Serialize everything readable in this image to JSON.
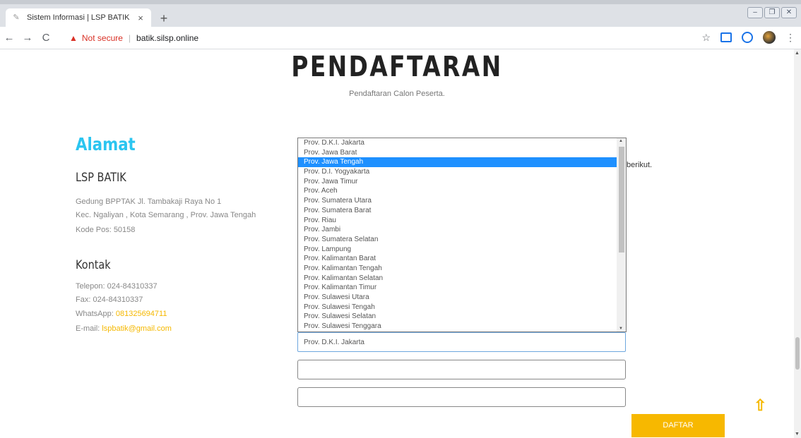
{
  "browser": {
    "tab_title": "Sistem Informasi | LSP BATIK",
    "tab_close": "×",
    "new_tab": "+",
    "security_text": "Not secure",
    "url": "batik.silsp.online"
  },
  "page": {
    "heading": "PENDAFTARAN",
    "subheading": "Pendaftaran Calon Peserta."
  },
  "sidebar": {
    "alamat_title": "Alamat",
    "org_name": "LSP BATIK",
    "address_line1": "Gedung BPPTAK Jl. Tambakaji Raya No 1",
    "address_line2": "Kec. Ngaliyan , Kota Semarang , Prov. Jawa Tengah",
    "postal": "Kode Pos: 50158",
    "kontak_title": "Kontak",
    "telepon": "Telepon: 024-84310337",
    "fax": "Fax: 024-84310337",
    "whatsapp_label": "WhatsApp: ",
    "whatsapp_value": "081325694711",
    "email_label": "E-mail: ",
    "email_value": "lspbatik@gmail.com"
  },
  "form": {
    "peek_text": "berikut.",
    "province_selected": "Prov. D.K.I. Jakarta",
    "submit_label": "DAFTAR"
  },
  "dropdown": {
    "highlighted_index": 2,
    "options": [
      "Prov. D.K.I. Jakarta",
      "Prov. Jawa Barat",
      "Prov. Jawa Tengah",
      "Prov. D.I. Yogyakarta",
      "Prov. Jawa Timur",
      "Prov. Aceh",
      "Prov. Sumatera Utara",
      "Prov. Sumatera Barat",
      "Prov. Riau",
      "Prov. Jambi",
      "Prov. Sumatera Selatan",
      "Prov. Lampung",
      "Prov. Kalimantan Barat",
      "Prov. Kalimantan Tengah",
      "Prov. Kalimantan Selatan",
      "Prov. Kalimantan Timur",
      "Prov. Sulawesi Utara",
      "Prov. Sulawesi Tengah",
      "Prov. Sulawesi Selatan",
      "Prov. Sulawesi Tenggara"
    ]
  },
  "icons": {
    "back": "←",
    "forward": "→",
    "reload": "C",
    "star": "☆",
    "menu": "⋮",
    "warning": "▲",
    "to_top": "⇧"
  }
}
